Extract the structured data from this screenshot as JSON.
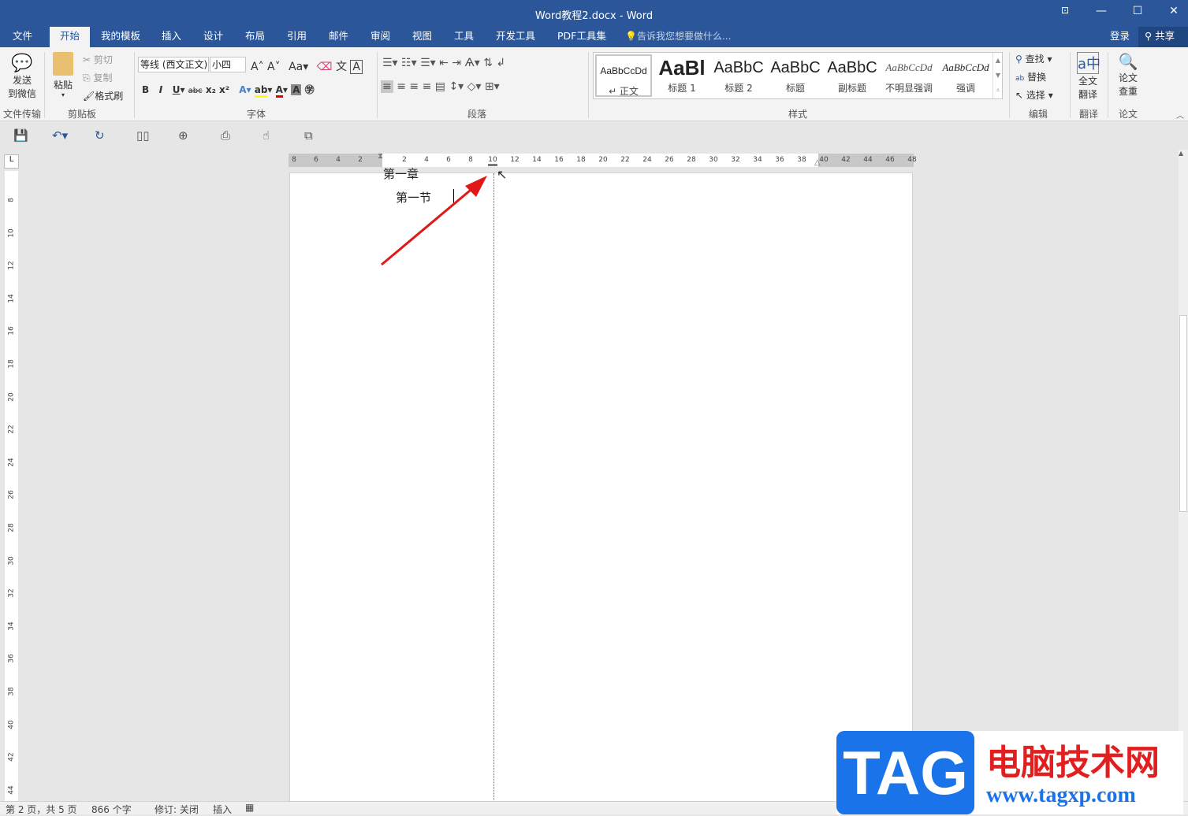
{
  "window": {
    "title": "Word教程2.docx - Word",
    "restore_icon": "ribbon-display-icon",
    "minimize": "—",
    "maximize": "☐",
    "close": "✕"
  },
  "tabs": [
    {
      "label": "文件"
    },
    {
      "label": "开始",
      "active": true
    },
    {
      "label": "我的模板"
    },
    {
      "label": "插入"
    },
    {
      "label": "设计"
    },
    {
      "label": "布局"
    },
    {
      "label": "引用"
    },
    {
      "label": "邮件"
    },
    {
      "label": "审阅"
    },
    {
      "label": "视图"
    },
    {
      "label": "工具"
    },
    {
      "label": "开发工具"
    },
    {
      "label": "PDF工具集"
    }
  ],
  "tell_me": "告诉我您想要做什么...",
  "account": {
    "login": "登录",
    "share": "共享"
  },
  "ribbon": {
    "wechat": {
      "label1": "发送",
      "label2": "到微信",
      "group": "文件传输"
    },
    "clipboard": {
      "paste": "粘贴",
      "cut": "剪切",
      "copy": "复制",
      "format_painter": "格式刷",
      "group": "剪贴板"
    },
    "font": {
      "name": "等线 (西文正文)",
      "size": "小四",
      "group": "字体",
      "bold": "B",
      "italic": "I",
      "underline": "U",
      "strike": "abc",
      "sub": "x₂",
      "sup": "x²",
      "font_color": "#e00000",
      "highlight_color": "#ffff00"
    },
    "paragraph": {
      "group": "段落"
    },
    "styles": {
      "group": "样式",
      "items": [
        {
          "sample": "AaBbCcDd",
          "name": "↵ 正文"
        },
        {
          "sample": "AaBl",
          "name": "标题 1"
        },
        {
          "sample": "AaBbC",
          "name": "标题 2"
        },
        {
          "sample": "AaBbC",
          "name": "标题"
        },
        {
          "sample": "AaBbC",
          "name": "副标题"
        },
        {
          "sample": "AaBbCcDd",
          "name": "不明显强调"
        },
        {
          "sample": "AaBbCcDd",
          "name": "强调"
        }
      ]
    },
    "editing": {
      "find": "查找",
      "replace": "替换",
      "select": "选择",
      "group": "编辑"
    },
    "translate": {
      "label1": "全文",
      "label2": "翻译",
      "group": "翻译"
    },
    "paper": {
      "label1": "论文",
      "label2": "查重",
      "group": "论文"
    }
  },
  "ruler": {
    "left": [
      "8",
      "6",
      "4",
      "2"
    ],
    "right": [
      "2",
      "4",
      "6",
      "8",
      "10",
      "12",
      "14",
      "16",
      "18",
      "20",
      "22",
      "24",
      "26",
      "28",
      "30",
      "32",
      "34",
      "36",
      "38",
      "40",
      "42",
      "44",
      "46",
      "48"
    ],
    "vertical": [
      "8",
      "10",
      "12",
      "14",
      "16",
      "18",
      "20",
      "22",
      "24",
      "26",
      "28",
      "30",
      "32",
      "34",
      "36",
      "38",
      "40",
      "42",
      "44"
    ]
  },
  "document": {
    "line1": "第一章",
    "line2": "第一节"
  },
  "status": {
    "page": "第 2 页，共 5 页",
    "words": "866 个字",
    "track": "修订: 关闭",
    "mode": "插入"
  },
  "watermark": {
    "logo": "TAG",
    "site_name": "电脑技术网",
    "url": "www.tagxp.com",
    "accent": "#1a73e8",
    "text_color": "#e02020"
  }
}
